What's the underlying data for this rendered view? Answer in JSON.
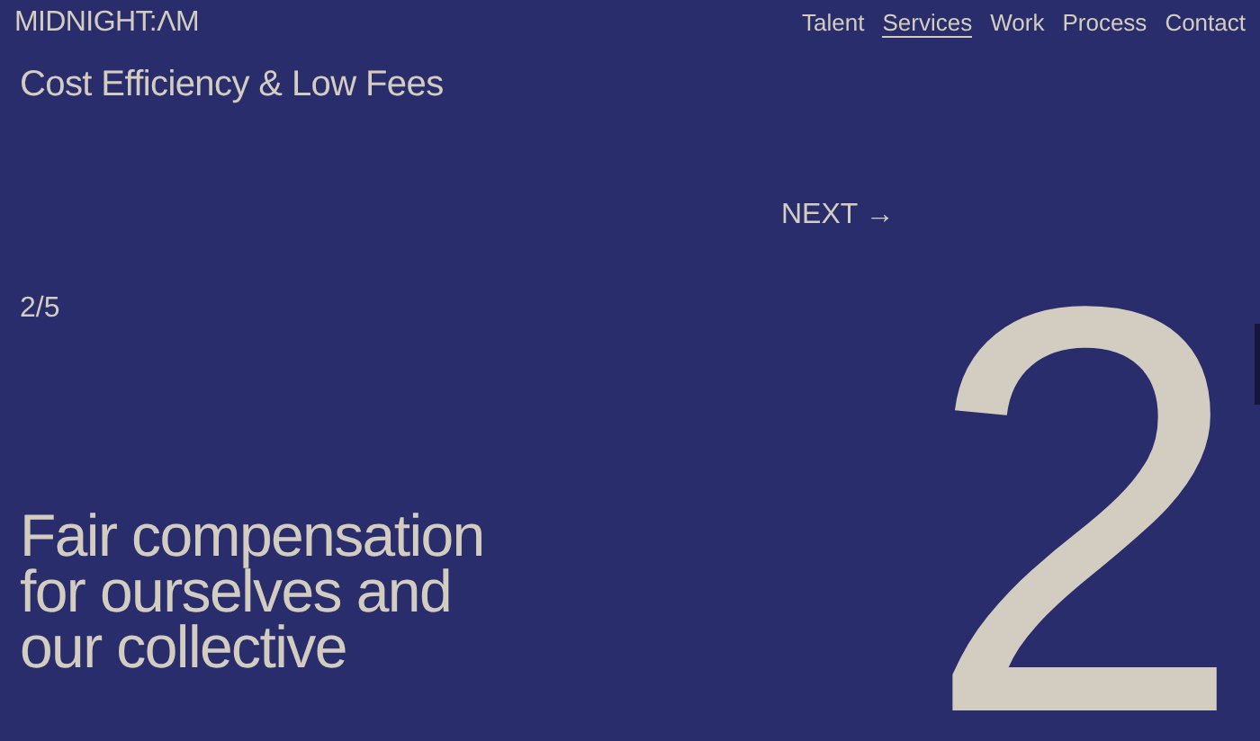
{
  "logo": "MIDNIGHT:ΛM",
  "nav": [
    {
      "label": "Talent",
      "selected": false
    },
    {
      "label": "Services",
      "selected": true
    },
    {
      "label": "Work",
      "selected": false
    },
    {
      "label": "Process",
      "selected": false
    },
    {
      "label": "Contact",
      "selected": false
    }
  ],
  "section_title": "Cost Efficiency & Low Fees",
  "next_button": {
    "label": "NEXT",
    "arrow": "→"
  },
  "counter": "2/5",
  "headline": "Fair compensation for ourselves and our collective",
  "big_number": "2"
}
